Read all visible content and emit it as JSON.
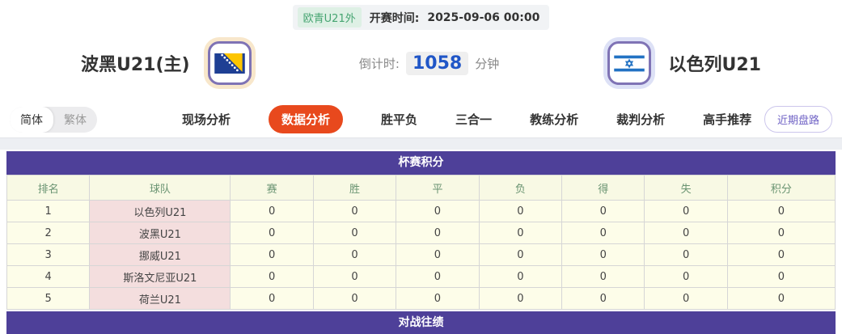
{
  "header": {
    "league_badge": "欧青U21外",
    "kickoff_label": "开赛时间:",
    "kickoff_time": "2025-09-06 00:00",
    "home_team": "波黑U21(主)",
    "away_team": "以色列U21",
    "countdown_label": "倒计时:",
    "countdown_value": "1058",
    "countdown_unit": "分钟",
    "home_flag_icon": "bosnia-flag-icon",
    "away_flag_icon": "israel-flag-icon"
  },
  "nav": {
    "lang_toggle": [
      {
        "label": "简体",
        "active": true
      },
      {
        "label": "繁体",
        "active": false
      }
    ],
    "items": [
      {
        "label": "现场分析",
        "active": false
      },
      {
        "label": "数据分析",
        "active": true
      },
      {
        "label": "胜平负",
        "active": false
      },
      {
        "label": "三合一",
        "active": false
      },
      {
        "label": "教练分析",
        "active": false
      },
      {
        "label": "裁判分析",
        "active": false
      },
      {
        "label": "高手推荐",
        "active": false
      }
    ],
    "recent_trend_button": "近期盘路"
  },
  "standings": {
    "title": "杯赛积分",
    "columns": [
      "排名",
      "球队",
      "赛",
      "胜",
      "平",
      "负",
      "得",
      "失",
      "积分"
    ],
    "rows": [
      {
        "rank": "1",
        "team": "以色列U21",
        "stats": [
          "0",
          "0",
          "0",
          "0",
          "0",
          "0",
          "0"
        ]
      },
      {
        "rank": "2",
        "team": "波黑U21",
        "stats": [
          "0",
          "0",
          "0",
          "0",
          "0",
          "0",
          "0"
        ]
      },
      {
        "rank": "3",
        "team": "挪威U21",
        "stats": [
          "0",
          "0",
          "0",
          "0",
          "0",
          "0",
          "0"
        ]
      },
      {
        "rank": "4",
        "team": "斯洛文尼亚U21",
        "stats": [
          "0",
          "0",
          "0",
          "0",
          "0",
          "0",
          "0"
        ]
      },
      {
        "rank": "5",
        "team": "荷兰U21",
        "stats": [
          "0",
          "0",
          "0",
          "0",
          "0",
          "0",
          "0"
        ]
      }
    ]
  },
  "h2h": {
    "title": "对战往绩"
  },
  "colors": {
    "accent_purple": "#4e4099",
    "active_tab_orange": "#e8491d",
    "badge_green_text": "#45a471",
    "badge_green_bg": "#def0e5",
    "countdown_blue": "#2056c7",
    "table_header_bg": "#f8f9e4",
    "table_header_text": "#6a9472",
    "row_bg": "#fdfde9",
    "team_cell_bg": "#f4dede",
    "pill_purple": "#6f62c5",
    "bosnia_blue": "#1e3f94",
    "bosnia_yellow": "#fdc500",
    "israel_blue": "#2272c3"
  }
}
